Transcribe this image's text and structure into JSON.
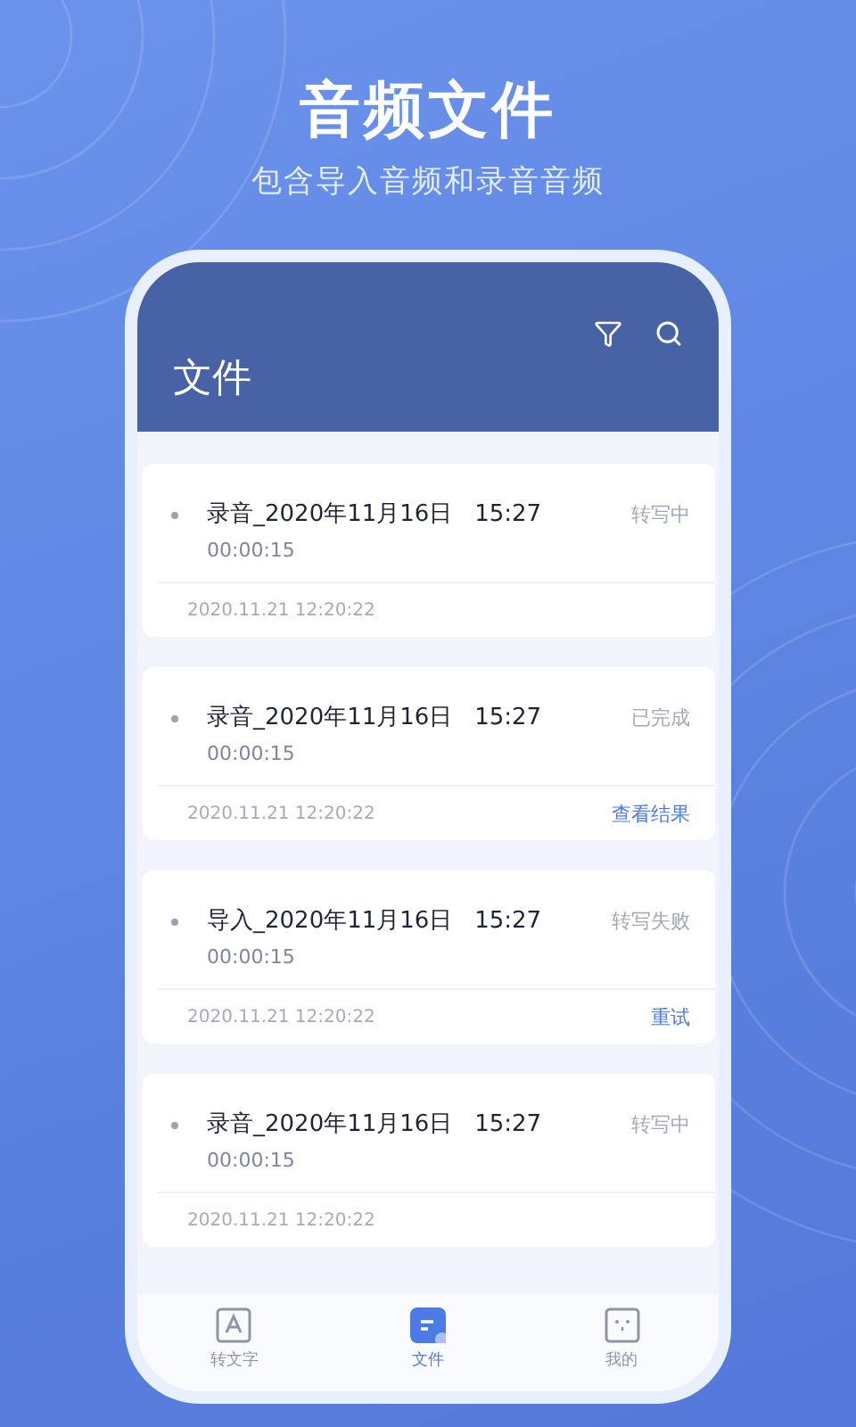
{
  "headline": "音频文件",
  "subheadline": "包含导入音频和录音音频",
  "screen": {
    "title": "文件",
    "files": [
      {
        "name": "录音_2020年11月16日   15:27",
        "duration": "00:00:15",
        "status": "转写中",
        "date": "2020.11.21 12:20:22"
      },
      {
        "name": "录音_2020年11月16日   15:27",
        "duration": "00:00:15",
        "status": "已完成",
        "date": "2020.11.21 12:20:22",
        "action": "查看结果"
      },
      {
        "name": "导入_2020年11月16日   15:27",
        "duration": "00:00:15",
        "status": "转写失败",
        "date": "2020.11.21 12:20:22",
        "action": "重试"
      },
      {
        "name": "录音_2020年11月16日   15:27",
        "duration": "00:00:15",
        "status": "转写中",
        "date": "2020.11.21 12:20:22"
      }
    ],
    "tabs": [
      {
        "label": "转文字",
        "kind": "transcribe",
        "selected": false
      },
      {
        "label": "文件",
        "kind": "files",
        "selected": true
      },
      {
        "label": "我的",
        "kind": "profile",
        "selected": false
      }
    ]
  }
}
